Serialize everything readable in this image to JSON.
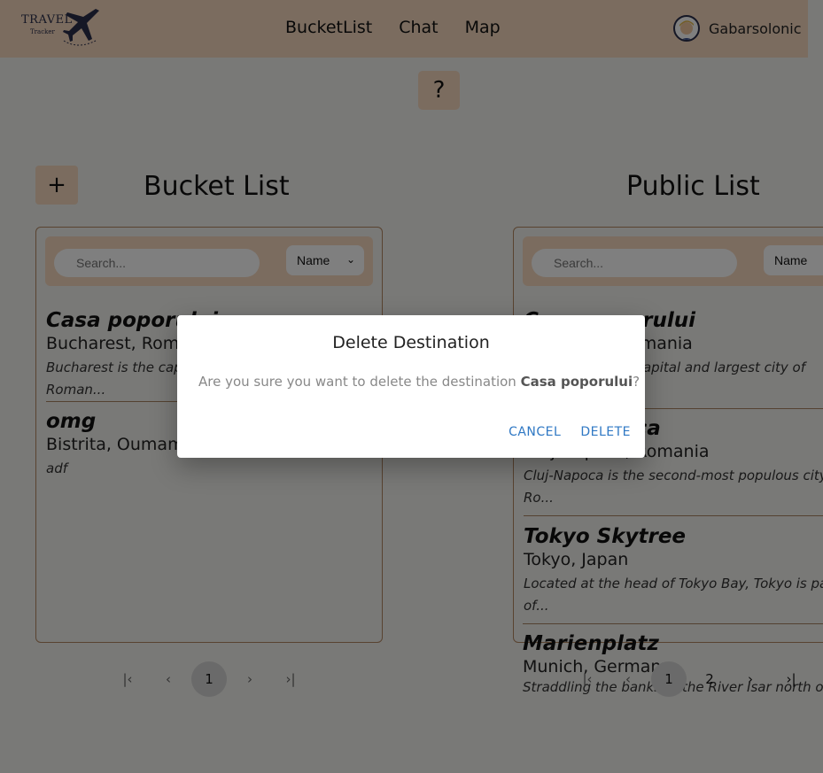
{
  "header": {
    "logo_text": "TRAVEL",
    "logo_sub": "Tracker",
    "nav": [
      "BucketList",
      "Chat",
      "Map"
    ],
    "user_name": "Gabarsolonic"
  },
  "help_label": "?",
  "add_label": "+",
  "bucket": {
    "title": "Bucket List",
    "search_placeholder": "Search...",
    "sort_value": "Name",
    "items": [
      {
        "title": "Casa poporului",
        "location": "Bucharest, Romania",
        "desc": "Bucharest is the capital and largest city of Roman..."
      },
      {
        "title": "omg",
        "location": "Bistrita, Oumamama",
        "desc": "adf"
      }
    ],
    "pager": {
      "current": "1"
    }
  },
  "public": {
    "title": "Public List",
    "search_placeholder": "Search...",
    "sort_value": "Name",
    "items": [
      {
        "title": "Casa poporului",
        "location": "Bucharest, Romania",
        "desc": "Bucharest is the capital and largest city of Roman..."
      },
      {
        "title": "Cluj-Napoca",
        "location": "Cluj-Napoca, Romania",
        "desc": "Cluj-Napoca is the second-most populous city in Ro..."
      },
      {
        "title": "Tokyo Skytree",
        "location": "Tokyo, Japan",
        "desc": "Located at the head of Tokyo Bay, Tokyo is part of..."
      },
      {
        "title": "Marienplatz",
        "location": "Munich, Germany",
        "desc": "Straddling the banks of the River Isar north of"
      }
    ],
    "pager": {
      "pages": [
        "1",
        "2"
      ]
    }
  },
  "dialog": {
    "title": "Delete Destination",
    "message": "Are you sure you want to delete the destination ",
    "target": "Casa poporului",
    "suffix": "?",
    "cancel": "CANCEL",
    "delete": "DELETE"
  }
}
